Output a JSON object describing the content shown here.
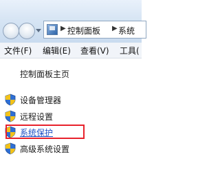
{
  "address_bar": {
    "breadcrumbs": [
      "控制面板",
      "系统"
    ],
    "separator": "▶",
    "location_icon": "control-panel-icon"
  },
  "menu": {
    "items": [
      "文件(F)",
      "编辑(E)",
      "查看(V)",
      "工具("
    ]
  },
  "task_pane": {
    "home_link": "控制面板主页",
    "links": [
      {
        "label": "设备管理器",
        "icon": "uac-shield-icon"
      },
      {
        "label": "远程设置",
        "icon": "uac-shield-icon"
      },
      {
        "label": "系统保护",
        "icon": "uac-shield-icon",
        "state": "hover-underlined"
      },
      {
        "label": "高级系统设置",
        "icon": "uac-shield-icon"
      }
    ]
  },
  "colors": {
    "highlight_box": "#e8212b",
    "active_link": "#1d4fc4",
    "shield_blue": "#2f6fd3",
    "shield_yellow": "#f3c219"
  }
}
